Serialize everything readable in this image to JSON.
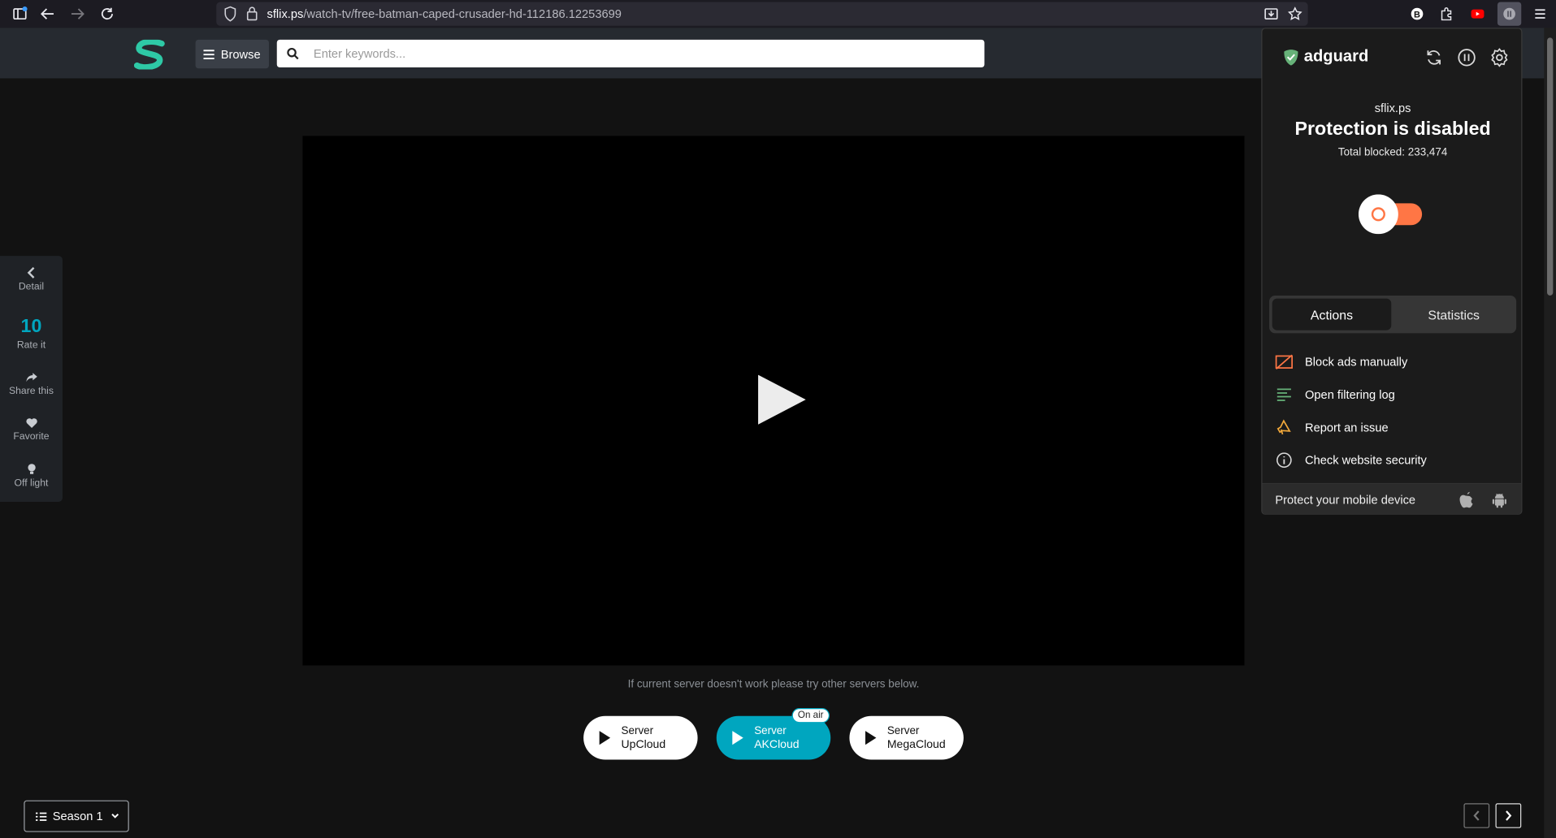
{
  "browser": {
    "url_host": "sflix.ps",
    "url_path": "/watch-tv/free-batman-caped-crusader-hd-112186.12253699"
  },
  "header": {
    "browse_label": "Browse",
    "search_placeholder": "Enter keywords..."
  },
  "sidebar": {
    "items": [
      {
        "label": "Detail",
        "icon": "chevron-left-icon"
      },
      {
        "label": "Rate it",
        "value": "10"
      },
      {
        "label": "Share this",
        "icon": "share-icon"
      },
      {
        "label": "Favorite",
        "icon": "heart-icon"
      },
      {
        "label": "Off light",
        "icon": "lightbulb-icon"
      }
    ]
  },
  "player": {
    "hint": "If current server doesn't work please try other servers below.",
    "servers": [
      {
        "prefix": "Server",
        "name": "UpCloud",
        "active": false
      },
      {
        "prefix": "Server",
        "name": "AKCloud",
        "active": true
      },
      {
        "prefix": "Server",
        "name": "MegaCloud",
        "active": false
      }
    ],
    "on_air_badge": "On air"
  },
  "season": {
    "label": "Season 1"
  },
  "adguard": {
    "brand": "adguard",
    "site": "sflix.ps",
    "status": "Protection is disabled",
    "total_blocked": "Total blocked: 233,474",
    "protection_enabled": false,
    "tabs": [
      "Actions",
      "Statistics"
    ],
    "actions": [
      {
        "label": "Block ads manually",
        "icon": "block-ads-icon"
      },
      {
        "label": "Open filtering log",
        "icon": "filtering-log-icon"
      },
      {
        "label": "Report an issue",
        "icon": "report-issue-icon"
      },
      {
        "label": "Check website security",
        "icon": "info-icon"
      }
    ],
    "footer": "Protect your mobile device",
    "colors": {
      "accent": "#ff7645",
      "brand_green": "#67b279",
      "cyan": "#00a6bf"
    }
  }
}
